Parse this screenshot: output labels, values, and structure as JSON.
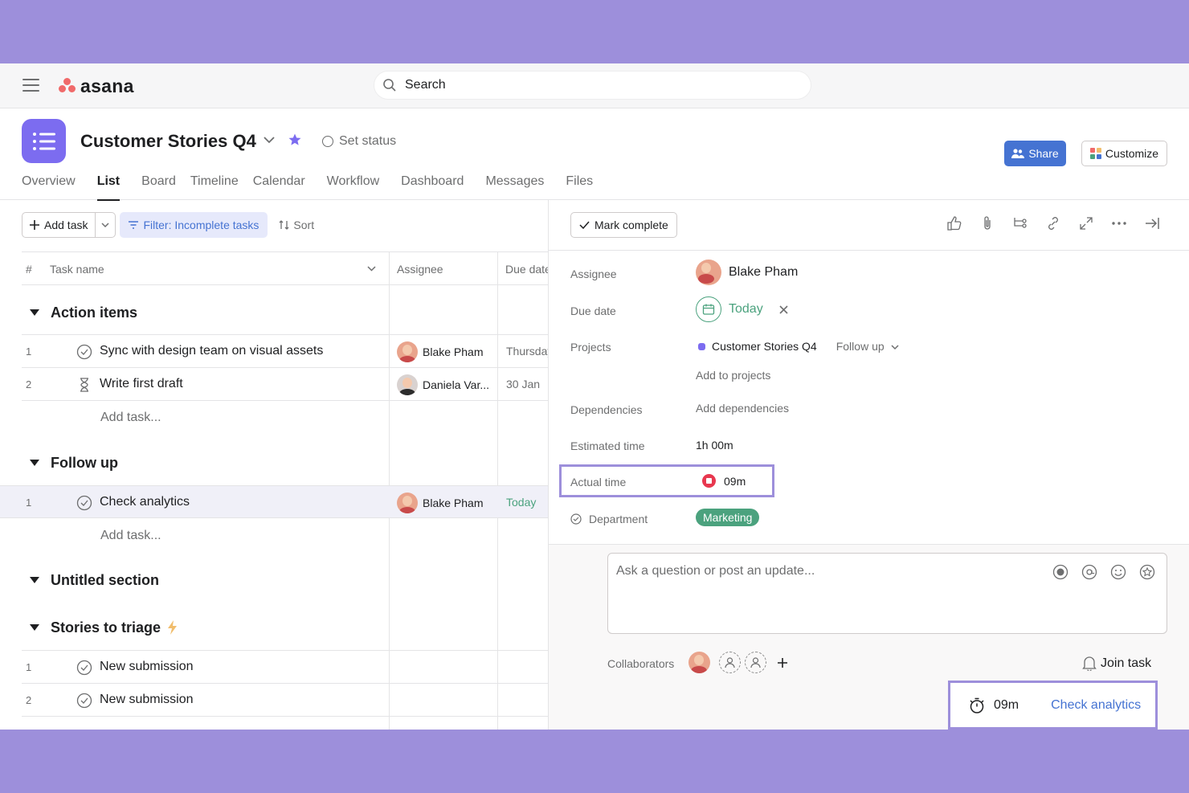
{
  "app": {
    "name": "asana"
  },
  "search": {
    "placeholder": "Search"
  },
  "project": {
    "title": "Customer Stories Q4",
    "set_status": "Set status",
    "share_label": "Share",
    "customize_label": "Customize",
    "tabs": [
      "Overview",
      "List",
      "Board",
      "Timeline",
      "Calendar",
      "Workflow",
      "Dashboard",
      "Messages",
      "Files"
    ],
    "active_tab": "List"
  },
  "toolbar": {
    "add_task": "Add task",
    "filter": "Filter: Incomplete tasks",
    "sort": "Sort"
  },
  "table": {
    "headers": {
      "num": "#",
      "task_name": "Task name",
      "assignee": "Assignee",
      "due_date": "Due date"
    },
    "add_task_label": "Add task...",
    "sections": [
      {
        "name": "Action items",
        "rows": [
          {
            "num": "1",
            "name": "Sync with design team on visual assets",
            "assignee": "Blake Pham",
            "due": "Thursday",
            "icon": "check-circle-icon"
          },
          {
            "num": "2",
            "name": "Write first draft",
            "assignee": "Daniela Var...",
            "due": "30 Jan",
            "icon": "hourglass-icon"
          }
        ]
      },
      {
        "name": "Follow up",
        "rows": [
          {
            "num": "1",
            "name": "Check analytics",
            "assignee": "Blake Pham",
            "due": "Today",
            "icon": "check-circle-icon"
          }
        ]
      },
      {
        "name": "Untitled section",
        "rows": []
      },
      {
        "name": "Stories to triage",
        "rows": [
          {
            "num": "1",
            "name": "New submission",
            "assignee": "",
            "due": "",
            "icon": "check-circle-icon"
          },
          {
            "num": "2",
            "name": "New submission",
            "assignee": "",
            "due": "",
            "icon": "check-circle-icon"
          }
        ]
      }
    ]
  },
  "detail": {
    "mark_complete": "Mark complete",
    "fields": {
      "assignee_label": "Assignee",
      "assignee_value": "Blake Pham",
      "due_label": "Due date",
      "due_value": "Today",
      "projects_label": "Projects",
      "project_value": "Customer Stories Q4",
      "project_section": "Follow up",
      "add_to_projects": "Add to projects",
      "dependencies_label": "Dependencies",
      "dependencies_value": "Add dependencies",
      "estimated_label": "Estimated time",
      "estimated_value": "1h 00m",
      "actual_label": "Actual time",
      "actual_value": "09m",
      "department_label": "Department",
      "department_value": "Marketing"
    },
    "comment_placeholder": "Ask a question or post an update...",
    "collaborators_label": "Collaborators",
    "join_task": "Join task",
    "timer": {
      "value": "09m",
      "task": "Check analytics"
    }
  },
  "colors": {
    "accent": "#4573d2",
    "brand_purple": "#7c6cf0",
    "frame": "#9d8fdb",
    "pill_green": "#4ba27e",
    "logo": "#f06a6a"
  }
}
